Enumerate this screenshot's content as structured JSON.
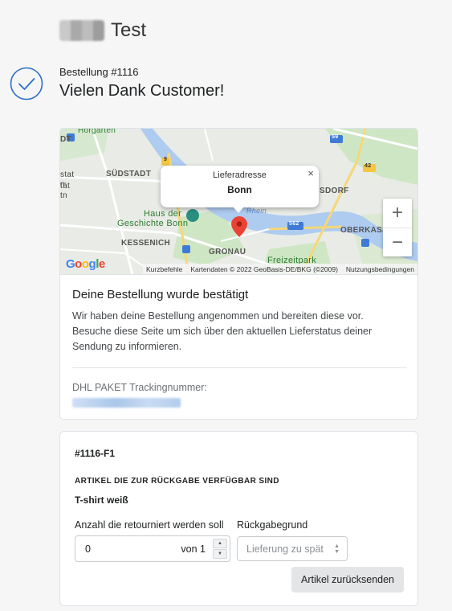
{
  "header": {
    "shop_name": "Test"
  },
  "order": {
    "number_label": "Bestellung #1116",
    "thanks": "Vielen Dank Customer!"
  },
  "map": {
    "popup_title": "Lieferadresse",
    "popup_city": "Bonn",
    "popup_close": "×",
    "zoom_in": "+",
    "zoom_out": "−",
    "labels": {
      "horgarten": "Horgarten",
      "suedstadt": "SÜDSTADT",
      "haus_line1": "Haus der",
      "haus_line2": "Geschichte Bonn",
      "kessenich": "KESSENICH",
      "gronau": "GRONAU",
      "rhein": "Rhein",
      "sdorf": "SDORF",
      "oberkass": "OBERKASS",
      "freizeitpark": "Freizeitpark",
      "edge_dt": "DT",
      "edge_stat": "stat",
      "edge_n": "n",
      "edge_tat": "tät",
      "edge_tn": "tn",
      "road_59": "59",
      "road_42": "42",
      "road_9": "9",
      "road_562": "562"
    },
    "footer": {
      "shortcuts": "Kurzbefehle",
      "attribution": "Kartendaten © 2022 GeoBasis-DE/BKG (©2009)",
      "terms": "Nutzungsbedingungen"
    },
    "google": "Google"
  },
  "status": {
    "heading": "Deine Bestellung wurde bestätigt",
    "text": "Wir haben deine Bestellung angenommen und bereiten diese vor. Besuche diese Seite um sich über den aktuellen Lieferstatus deiner Sendung zu informieren.",
    "tracking_label": "DHL PAKET Trackingnummer:"
  },
  "returns": {
    "fulfillment_id": "#1116-F1",
    "section_caption": "ARTIKEL DIE ZUR RÜCKGABE VERFÜGBAR SIND",
    "item_name": "T-shirt weiß",
    "qty_label": "Anzahl die retourniert werden soll",
    "reason_label": "Rückgabegrund",
    "qty_value": "0",
    "qty_of": "von 1",
    "reason_selected": "Lieferung zu spät",
    "submit_label": "Artikel zurücksenden"
  },
  "colors": {
    "accent": "#2c6ecb",
    "pin": "#ea4335",
    "button_bg": "#e4e5e7"
  }
}
